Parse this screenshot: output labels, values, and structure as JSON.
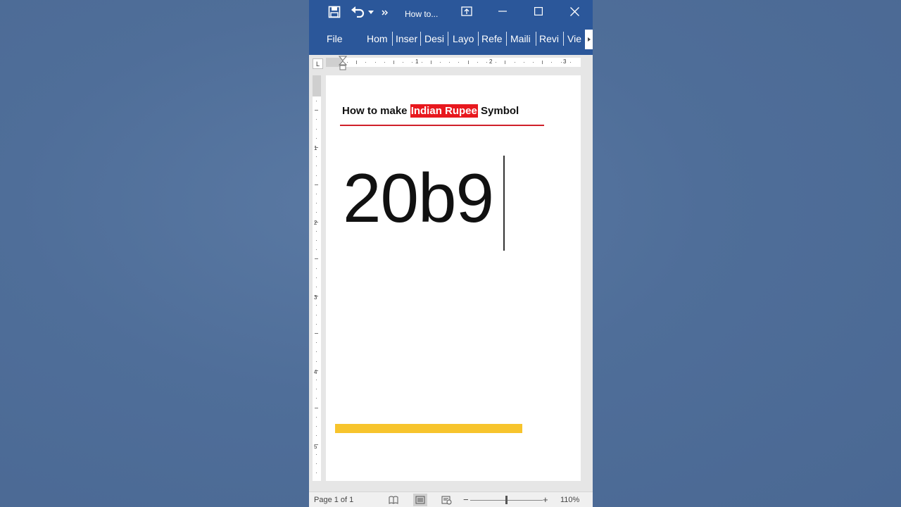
{
  "titlebar": {
    "title": "How to...",
    "icons": [
      "save-icon",
      "undo-icon",
      "undo-dropdown-icon",
      "more-commands-icon",
      "ribbon-display-options-icon",
      "minimize-icon",
      "maximize-icon",
      "close-icon"
    ]
  },
  "ribbon": {
    "tabs": [
      "File",
      "Hom",
      "Inser",
      "Desi",
      "Layo",
      "Refe",
      "Maili",
      "Revi",
      "Vie"
    ]
  },
  "ruler": {
    "horizontal_numbers": [
      "1",
      "2",
      "3"
    ],
    "vertical_numbers": [
      "1",
      "2",
      "3",
      "4",
      "5"
    ],
    "tab_selector": "L"
  },
  "document": {
    "heading_before": "How to make ",
    "heading_highlight": "Indian Rupee",
    "heading_after": " Symbol",
    "body_text": "20b9",
    "colors": {
      "highlight": "#e8181e",
      "underline": "#d0202a",
      "bar": "#f7c42c"
    }
  },
  "statusbar": {
    "page_info": "Page 1 of 1",
    "zoom": "110%",
    "zoom_out": "−",
    "zoom_in": "+"
  }
}
